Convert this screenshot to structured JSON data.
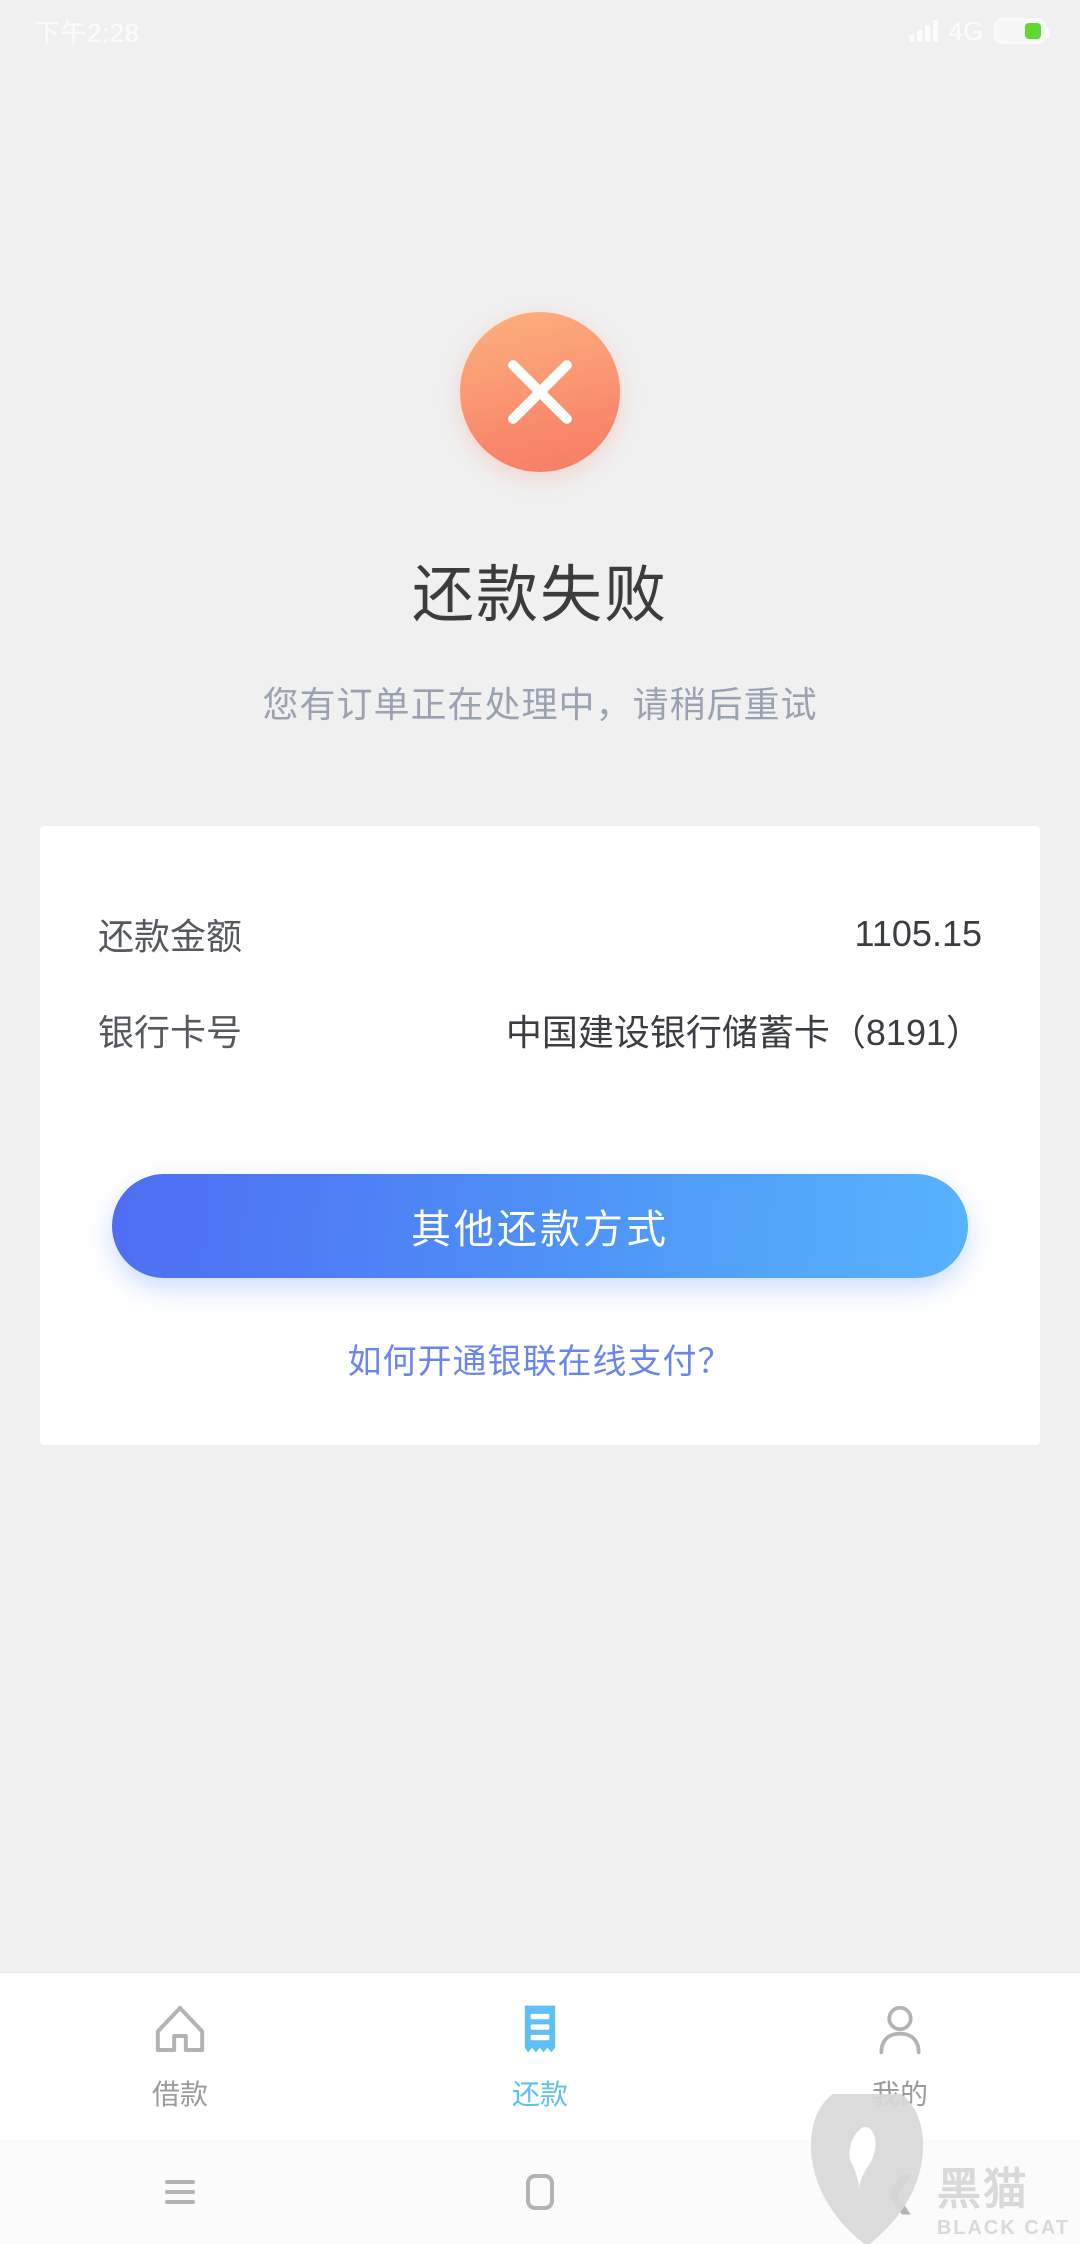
{
  "status_bar": {
    "time": "下午2:28",
    "carrier": "",
    "signal_icon": "signal-bars-icon",
    "network_label": "4G",
    "battery_icon": "battery-charging-icon"
  },
  "hero": {
    "icon": "error-cross-icon",
    "title": "还款失败",
    "subtitle": "您有订单正在处理中，请稍后重试"
  },
  "card": {
    "rows": [
      {
        "label": "还款金额",
        "value": "1105.15"
      },
      {
        "label": "银行卡号",
        "value": "中国建设银行储蓄卡（8191）"
      }
    ],
    "primary_button": "其他还款方式",
    "help_link": "如何开通银联在线支付？"
  },
  "tab_bar": {
    "tabs": [
      {
        "label": "借款",
        "icon": "home-icon",
        "active": false
      },
      {
        "label": "还款",
        "icon": "receipt-icon",
        "active": true
      },
      {
        "label": "我的",
        "icon": "person-icon",
        "active": false
      }
    ]
  },
  "nav_bar": {
    "recents": "menu-icon",
    "home": "home-square-icon",
    "back": "back-chevron-icon"
  },
  "watermark": {
    "cn": "黑猫",
    "en": "BLACK CAT",
    "icon": "black-cat-logo-icon"
  },
  "colors": {
    "accent_blue": "#4e8af5",
    "link_blue": "#6b85f0",
    "tab_active": "#5fc0f7",
    "error_orange": "#f8866a",
    "page_bg": "#f0f0f0",
    "card_bg": "#ffffff"
  }
}
